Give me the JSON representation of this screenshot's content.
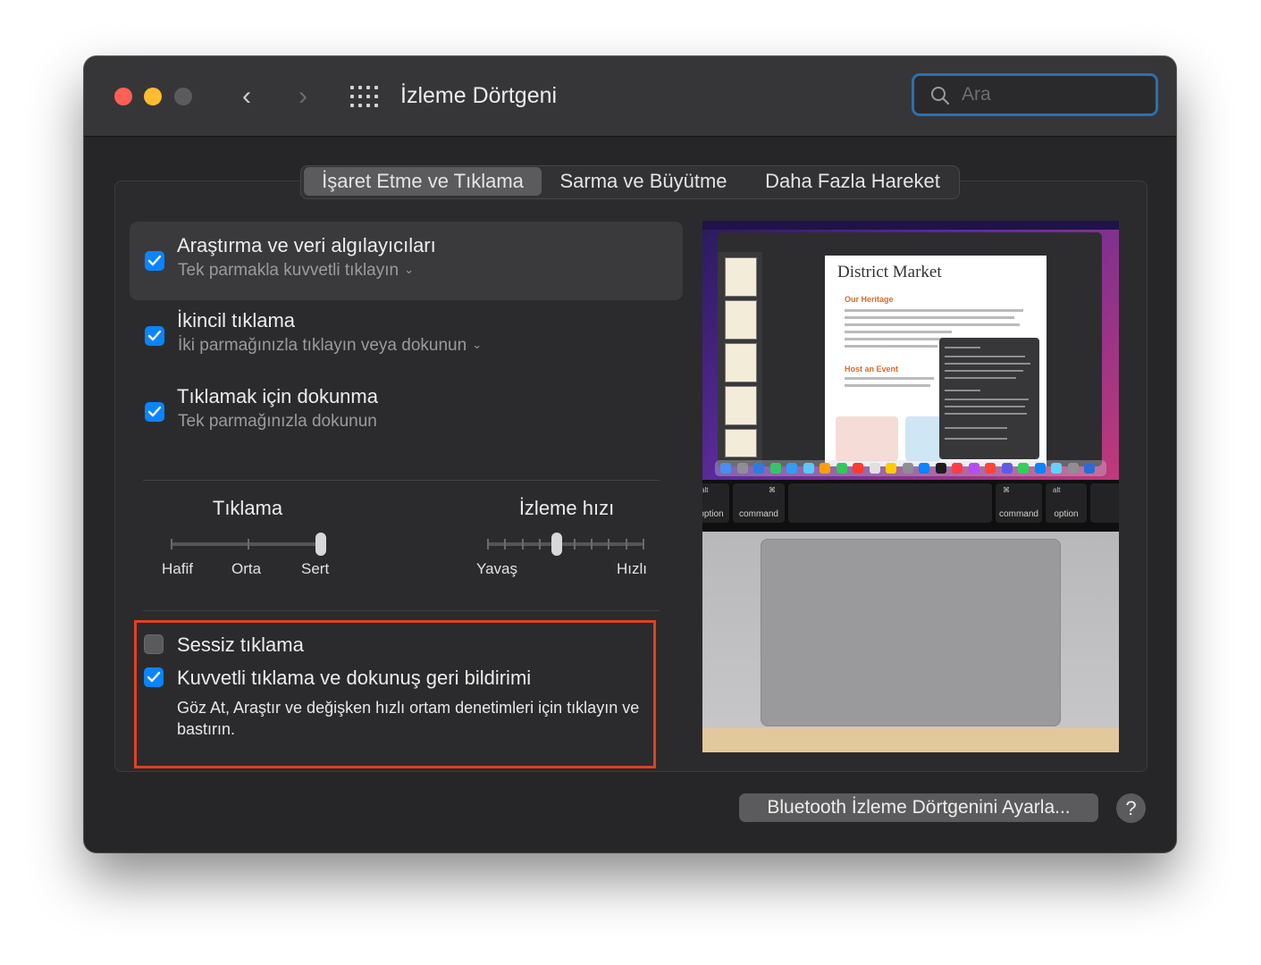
{
  "window": {
    "title": "İzleme Dörtgeni",
    "search_placeholder": "Ara"
  },
  "tabs": [
    {
      "label": "İşaret Etme ve Tıklama",
      "selected": true
    },
    {
      "label": "Sarma ve Büyütme",
      "selected": false
    },
    {
      "label": "Daha Fazla Hareket",
      "selected": false
    }
  ],
  "options": [
    {
      "label": "Araştırma ve veri algılayıcıları",
      "sub": "Tek parmakla kuvvetli tıklayın",
      "checked": true,
      "has_menu": true
    },
    {
      "label": "İkincil tıklama",
      "sub": "İki parmağınızla tıklayın veya dokunun",
      "checked": true,
      "has_menu": true
    },
    {
      "label": "Tıklamak için dokunma",
      "sub": "Tek parmağınızla dokunun",
      "checked": true,
      "has_menu": false
    }
  ],
  "click_slider": {
    "title": "Tıklama",
    "labels": [
      "Hafif",
      "Orta",
      "Sert"
    ],
    "selected": "Sert"
  },
  "speed_slider": {
    "title": "İzleme hızı",
    "min_label": "Yavaş",
    "max_label": "Hızlı",
    "value_step": 4,
    "steps": 10
  },
  "silent_click": {
    "label": "Sessiz tıklama",
    "checked": false
  },
  "force_click": {
    "label": "Kuvvetli tıklama ve dokunuş geri bildirimi",
    "checked": true,
    "description": "Göz At, Araştır ve değişken hızlı ortam denetimleri için tıklayın ve bastırın."
  },
  "preview": {
    "doc_title": "District Market",
    "doc_heading": "Our Heritage",
    "doc_heading2": "Host an Event",
    "key_labels": [
      "option",
      "command",
      "command",
      "option"
    ],
    "key_symbols": [
      "alt",
      "⌘",
      "⌘",
      "alt"
    ]
  },
  "footer": {
    "bluetooth_button": "Bluetooth İzleme Dörtgenini Ayarla...",
    "help_button": "?"
  }
}
